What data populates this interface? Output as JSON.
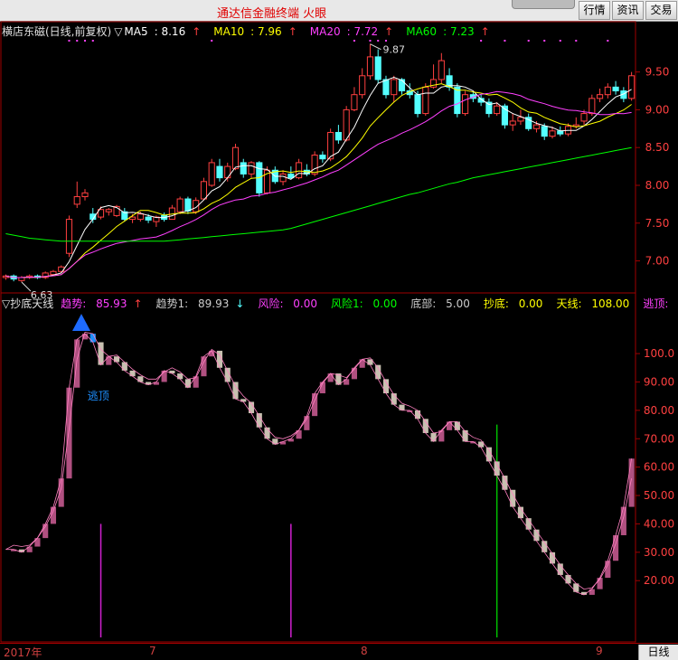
{
  "window": {
    "title": "通达信金融终端  火眼",
    "buttons": [
      "行情",
      "资讯",
      "交易"
    ]
  },
  "main_chart": {
    "stock_label": "横店东磁(日线,前复权)",
    "ma_prefix": "▽",
    "ma": [
      {
        "name": "MA5",
        "value": "8.16",
        "color": "#ffffff"
      },
      {
        "name": "MA10",
        "value": "7.96",
        "color": "#ffff00"
      },
      {
        "name": "MA20",
        "value": "7.72",
        "color": "#ff40ff"
      },
      {
        "name": "MA60",
        "value": "7.23",
        "color": "#00ff00"
      }
    ],
    "high_label": "9.87",
    "low_label": "6.63",
    "y_ticks": [
      "9.50",
      "9.00",
      "8.50",
      "8.00",
      "7.50",
      "7.00"
    ],
    "colors": {
      "up": "#ff4040",
      "down": "#54ffff",
      "axis": "#a00000"
    }
  },
  "indicator": {
    "name": "▽抄底天线",
    "items": [
      {
        "label": "趋势:",
        "value": "85.93",
        "arrow": "↑",
        "label_color": "#ff40ff",
        "value_color": "#ff40ff"
      },
      {
        "label": "趋势1:",
        "value": "89.93",
        "arrow": "↓",
        "label_color": "#cccccc",
        "value_color": "#cccccc"
      },
      {
        "label": "风险:",
        "value": "0.00",
        "arrow": "",
        "label_color": "#ff40ff",
        "value_color": "#ff40ff"
      },
      {
        "label": "风险1:",
        "value": "0.00",
        "arrow": "",
        "label_color": "#00ff00",
        "value_color": "#00ff00"
      },
      {
        "label": "底部:",
        "value": "5.00",
        "arrow": "",
        "label_color": "#cccccc",
        "value_color": "#cccccc"
      },
      {
        "label": "抄底:",
        "value": "0.00",
        "arrow": "",
        "label_color": "#ffff00",
        "value_color": "#ffff00"
      },
      {
        "label": "天线:",
        "value": "108.00",
        "arrow": "",
        "label_color": "#ffff00",
        "value_color": "#ffff00"
      },
      {
        "label": "逃顶:",
        "value": "0.00",
        "arrow": "",
        "label_color": "#ff40ff",
        "value_color": "#ff40ff"
      }
    ],
    "escape_label": "逃顶",
    "y_ticks": [
      "100.0",
      "90.00",
      "80.00",
      "70.00",
      "60.00",
      "50.00",
      "40.00",
      "30.00",
      "20.00"
    ],
    "colors": {
      "rise": "#b05080",
      "fall": "#c8c0b0",
      "escape": "#1e90ff"
    }
  },
  "bottom": {
    "dates": [
      "2017年",
      "7",
      "8",
      "9"
    ],
    "timeframe_tab": "日线"
  },
  "chart_data": {
    "type": "candlestick",
    "price_ylim": [
      6.6,
      9.95
    ],
    "candles": [
      [
        6.78,
        6.8,
        6.82,
        6.75
      ],
      [
        6.8,
        6.76,
        6.82,
        6.73
      ],
      [
        6.74,
        6.78,
        6.8,
        6.72
      ],
      [
        6.78,
        6.8,
        6.82,
        6.76
      ],
      [
        6.8,
        6.78,
        6.82,
        6.76
      ],
      [
        6.78,
        6.84,
        6.86,
        6.76
      ],
      [
        6.82,
        6.86,
        6.88,
        6.8
      ],
      [
        6.86,
        6.92,
        6.94,
        6.84
      ],
      [
        7.1,
        7.55,
        7.6,
        7.05
      ],
      [
        7.75,
        7.85,
        8.05,
        7.7
      ],
      [
        7.85,
        7.9,
        7.95,
        7.8
      ],
      [
        7.62,
        7.55,
        7.7,
        7.5
      ],
      [
        7.58,
        7.68,
        7.72,
        7.55
      ],
      [
        7.65,
        7.68,
        7.7,
        7.6
      ],
      [
        7.6,
        7.72,
        7.74,
        7.58
      ],
      [
        7.65,
        7.55,
        7.7,
        7.52
      ],
      [
        7.55,
        7.58,
        7.62,
        7.5
      ],
      [
        7.55,
        7.62,
        7.65,
        7.52
      ],
      [
        7.58,
        7.54,
        7.62,
        7.5
      ],
      [
        7.52,
        7.58,
        7.6,
        7.45
      ],
      [
        7.6,
        7.55,
        7.64,
        7.52
      ],
      [
        7.55,
        7.7,
        7.74,
        7.55
      ],
      [
        7.65,
        7.82,
        7.85,
        7.62
      ],
      [
        7.82,
        7.66,
        7.85,
        7.62
      ],
      [
        7.65,
        7.8,
        7.84,
        7.62
      ],
      [
        7.82,
        8.05,
        8.1,
        7.8
      ],
      [
        8.0,
        8.3,
        8.35,
        7.98
      ],
      [
        8.25,
        8.1,
        8.35,
        8.05
      ],
      [
        8.1,
        8.25,
        8.3,
        8.05
      ],
      [
        8.22,
        8.5,
        8.55,
        8.2
      ],
      [
        8.3,
        8.15,
        8.35,
        8.1
      ],
      [
        8.15,
        8.3,
        8.32,
        8.1
      ],
      [
        8.3,
        7.9,
        8.32,
        7.85
      ],
      [
        7.9,
        8.2,
        8.25,
        7.88
      ],
      [
        8.2,
        8.05,
        8.25,
        8.02
      ],
      [
        8.05,
        8.15,
        8.2,
        8.0
      ],
      [
        8.15,
        8.1,
        8.25,
        8.08
      ],
      [
        8.1,
        8.3,
        8.35,
        8.08
      ],
      [
        8.2,
        8.15,
        8.28,
        8.12
      ],
      [
        8.15,
        8.4,
        8.45,
        8.12
      ],
      [
        8.4,
        8.35,
        8.45,
        8.3
      ],
      [
        8.35,
        8.7,
        8.75,
        8.32
      ],
      [
        8.7,
        8.6,
        8.8,
        8.55
      ],
      [
        8.6,
        9.0,
        9.05,
        8.58
      ],
      [
        9.0,
        9.2,
        9.3,
        8.98
      ],
      [
        9.2,
        9.45,
        9.55,
        9.15
      ],
      [
        9.45,
        9.7,
        9.87,
        9.4
      ],
      [
        9.7,
        9.4,
        9.8,
        9.35
      ],
      [
        9.4,
        9.2,
        9.45,
        9.15
      ],
      [
        9.2,
        9.4,
        9.45,
        9.1
      ],
      [
        9.4,
        9.25,
        9.42,
        9.2
      ],
      [
        9.25,
        9.2,
        9.35,
        9.15
      ],
      [
        9.2,
        8.95,
        9.25,
        8.9
      ],
      [
        8.95,
        9.3,
        9.35,
        8.92
      ],
      [
        9.3,
        9.4,
        9.6,
        9.28
      ],
      [
        9.4,
        9.65,
        9.75,
        9.35
      ],
      [
        9.45,
        9.3,
        9.55,
        9.25
      ],
      [
        9.3,
        8.95,
        9.35,
        8.9
      ],
      [
        8.95,
        9.2,
        9.25,
        8.92
      ],
      [
        9.2,
        9.15,
        9.25,
        9.1
      ],
      [
        9.15,
        9.1,
        9.2,
        9.05
      ],
      [
        9.1,
        8.95,
        9.15,
        8.9
      ],
      [
        8.95,
        9.05,
        9.1,
        8.92
      ],
      [
        9.05,
        8.8,
        9.08,
        8.75
      ],
      [
        8.8,
        8.85,
        8.95,
        8.72
      ],
      [
        8.85,
        8.9,
        9.0,
        8.8
      ],
      [
        8.9,
        8.75,
        8.95,
        8.72
      ],
      [
        8.75,
        8.8,
        8.85,
        8.7
      ],
      [
        8.78,
        8.65,
        8.82,
        8.6
      ],
      [
        8.65,
        8.72,
        8.78,
        8.62
      ],
      [
        8.72,
        8.68,
        8.78,
        8.65
      ],
      [
        8.68,
        8.78,
        8.82,
        8.65
      ],
      [
        8.78,
        8.8,
        8.9,
        8.75
      ],
      [
        8.85,
        8.95,
        9.0,
        8.8
      ],
      [
        8.95,
        9.15,
        9.2,
        8.92
      ],
      [
        9.15,
        9.2,
        9.28,
        9.1
      ],
      [
        9.2,
        9.3,
        9.35,
        9.15
      ],
      [
        9.3,
        9.25,
        9.38,
        9.2
      ],
      [
        9.25,
        9.15,
        9.3,
        9.1
      ],
      [
        9.15,
        9.45,
        9.5,
        9.12
      ]
    ],
    "ma60": [
      7.36,
      7.34,
      7.32,
      7.3,
      7.29,
      7.28,
      7.27,
      7.26,
      7.26,
      7.26,
      7.26,
      7.26,
      7.26,
      7.26,
      7.26,
      7.26,
      7.26,
      7.26,
      7.26,
      7.26,
      7.26,
      7.27,
      7.28,
      7.29,
      7.3,
      7.31,
      7.32,
      7.33,
      7.34,
      7.35,
      7.36,
      7.37,
      7.38,
      7.39,
      7.4,
      7.41,
      7.43,
      7.46,
      7.49,
      7.52,
      7.55,
      7.58,
      7.61,
      7.64,
      7.67,
      7.7,
      7.73,
      7.76,
      7.79,
      7.82,
      7.85,
      7.88,
      7.9,
      7.93,
      7.96,
      7.99,
      8.02,
      8.04,
      8.07,
      8.1,
      8.12,
      8.14,
      8.16,
      8.18,
      8.2,
      8.22,
      8.24,
      8.26,
      8.28,
      8.3,
      8.32,
      8.34,
      8.36,
      8.38,
      8.4,
      8.42,
      8.44,
      8.46,
      8.48,
      8.5
    ],
    "indicator_ylim": [
      0,
      115
    ],
    "trend": [
      31,
      31,
      30,
      32,
      35,
      40,
      46,
      56,
      88,
      105,
      107,
      104,
      96,
      99,
      97,
      94,
      92,
      90,
      89,
      90,
      94,
      93,
      91,
      88,
      92,
      99,
      101,
      95,
      90,
      84,
      83,
      79,
      74,
      70,
      68,
      69,
      70,
      73,
      78,
      86,
      90,
      93,
      89,
      91,
      95,
      98,
      96,
      91,
      86,
      82,
      80,
      80,
      77,
      72,
      69,
      73,
      76,
      73,
      69,
      69,
      67,
      62,
      57,
      52,
      46,
      42,
      38,
      34,
      30,
      26,
      22,
      19,
      16,
      15,
      17,
      21,
      27,
      36,
      46,
      63
    ],
    "spikes": [
      {
        "index": 12,
        "value": 40,
        "color": "#d020d0"
      },
      {
        "index": 36,
        "value": 40,
        "color": "#d020d0"
      },
      {
        "index": 62,
        "value": 75,
        "color": "#00c000"
      }
    ]
  }
}
